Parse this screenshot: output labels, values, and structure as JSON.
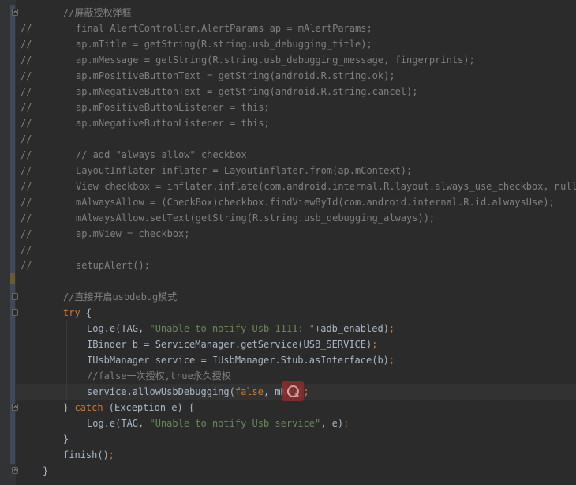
{
  "editor": {
    "lines": [
      {
        "comment_prefix": "",
        "indent": 80,
        "fold": "up",
        "tokens": [
          {
            "t": "//屏蔽授权弹框",
            "c": "#808080"
          }
        ]
      },
      {
        "comment_prefix": "//",
        "indent": 96,
        "tokens": [
          {
            "t": "final AlertController.AlertParams ap = mAlertParams;",
            "c": "#808080"
          }
        ]
      },
      {
        "comment_prefix": "//",
        "indent": 96,
        "tokens": [
          {
            "t": "ap.mTitle = getString(R.string.usb_debugging_title);",
            "c": "#808080"
          }
        ]
      },
      {
        "comment_prefix": "//",
        "indent": 96,
        "tokens": [
          {
            "t": "ap.mMessage = getString(R.string.usb_debugging_message, fingerprints);",
            "c": "#808080"
          }
        ]
      },
      {
        "comment_prefix": "//",
        "indent": 96,
        "tokens": [
          {
            "t": "ap.mPositiveButtonText = getString(android.R.string.ok);",
            "c": "#808080"
          }
        ]
      },
      {
        "comment_prefix": "//",
        "indent": 96,
        "tokens": [
          {
            "t": "ap.mNegativeButtonText = getString(android.R.string.cancel);",
            "c": "#808080"
          }
        ]
      },
      {
        "comment_prefix": "//",
        "indent": 96,
        "tokens": [
          {
            "t": "ap.mPositiveButtonListener = this;",
            "c": "#808080"
          }
        ]
      },
      {
        "comment_prefix": "//",
        "indent": 96,
        "tokens": [
          {
            "t": "ap.mNegativeButtonListener = this;",
            "c": "#808080"
          }
        ]
      },
      {
        "comment_prefix": "//",
        "indent": 96,
        "tokens": []
      },
      {
        "comment_prefix": "//",
        "indent": 96,
        "tokens": [
          {
            "t": "// add \"always allow\" checkbox",
            "c": "#808080"
          }
        ]
      },
      {
        "comment_prefix": "//",
        "indent": 96,
        "tokens": [
          {
            "t": "LayoutInflater inflater = LayoutInflater.from(ap.mContext);",
            "c": "#808080"
          }
        ]
      },
      {
        "comment_prefix": "//",
        "indent": 96,
        "tokens": [
          {
            "t": "View checkbox = inflater.inflate(com.android.internal.R.layout.always_use_checkbox, null);",
            "c": "#808080"
          }
        ]
      },
      {
        "comment_prefix": "//",
        "indent": 96,
        "tokens": [
          {
            "t": "mAlwaysAllow = (CheckBox)checkbox.findViewById(com.android.internal.R.id.alwaysUse);",
            "c": "#808080"
          }
        ]
      },
      {
        "comment_prefix": "//",
        "indent": 96,
        "tokens": [
          {
            "t": "mAlwaysAllow.setText(getString(R.string.usb_debugging_always));",
            "c": "#808080"
          }
        ]
      },
      {
        "comment_prefix": "//",
        "indent": 96,
        "tokens": [
          {
            "t": "ap.mView = checkbox;",
            "c": "#808080"
          }
        ]
      },
      {
        "comment_prefix": "//",
        "indent": 96,
        "tokens": []
      },
      {
        "comment_prefix": "//",
        "indent": 96,
        "tokens": [
          {
            "t": "setupAlert();",
            "c": "#808080"
          }
        ]
      },
      {
        "comment_prefix": "",
        "indent": 80,
        "tokens": []
      },
      {
        "comment_prefix": "",
        "indent": 80,
        "fold": "down",
        "tokens": [
          {
            "t": "//直接开启usbdebug模式",
            "c": "#808080"
          }
        ]
      },
      {
        "comment_prefix": "",
        "indent": 80,
        "fold": "down",
        "tokens": [
          {
            "t": "try",
            "c": "#cc7832"
          },
          {
            "t": " {",
            "c": "#a9b7c6"
          }
        ]
      },
      {
        "comment_prefix": "",
        "indent": 110,
        "tokens": [
          {
            "t": "Log.e(TAG, ",
            "c": "#a9b7c6"
          },
          {
            "t": "\"Unable to notify Usb 1111: \"",
            "c": "#6a8759"
          },
          {
            "t": "+adb_enabled)",
            "c": "#a9b7c6"
          },
          {
            "t": ";",
            "c": "#cc7832"
          }
        ]
      },
      {
        "comment_prefix": "",
        "indent": 110,
        "tokens": [
          {
            "t": "IBinder b = ServiceManager.getService(USB_SERVICE)",
            "c": "#a9b7c6"
          },
          {
            "t": ";",
            "c": "#cc7832"
          }
        ]
      },
      {
        "comment_prefix": "",
        "indent": 110,
        "tokens": [
          {
            "t": "IUsbManager service = IUsbManager.Stub.asInterface(b)",
            "c": "#a9b7c6"
          },
          {
            "t": ";",
            "c": "#cc7832"
          }
        ]
      },
      {
        "comment_prefix": "",
        "indent": 110,
        "tokens": [
          {
            "t": "//false一次授权,true永久授权",
            "c": "#808080"
          }
        ]
      },
      {
        "comment_prefix": "",
        "indent": 110,
        "tokens": [
          {
            "t": "service.allowUsbDebugging(",
            "c": "#a9b7c6"
          },
          {
            "t": "false",
            "c": "#cc7832"
          },
          {
            "t": ", mKey)",
            "c": "#a9b7c6"
          },
          {
            "t": ";",
            "c": "#cc7832"
          }
        ]
      },
      {
        "comment_prefix": "",
        "indent": 80,
        "fold": "up",
        "tokens": [
          {
            "t": "} ",
            "c": "#a9b7c6"
          },
          {
            "t": "catch",
            "c": "#cc7832"
          },
          {
            "t": " (Exception e) {",
            "c": "#a9b7c6"
          }
        ]
      },
      {
        "comment_prefix": "",
        "indent": 110,
        "tokens": [
          {
            "t": "Log.e(TAG, ",
            "c": "#a9b7c6"
          },
          {
            "t": "\"Unable to notify Usb service\"",
            "c": "#6a8759"
          },
          {
            "t": ", e)",
            "c": "#a9b7c6"
          },
          {
            "t": ";",
            "c": "#cc7832"
          }
        ]
      },
      {
        "comment_prefix": "",
        "indent": 80,
        "tokens": [
          {
            "t": "}",
            "c": "#a9b7c6"
          }
        ]
      },
      {
        "comment_prefix": "",
        "indent": 80,
        "tokens": [
          {
            "t": "finish()",
            "c": "#a9b7c6"
          },
          {
            "t": ";",
            "c": "#cc7832"
          }
        ]
      },
      {
        "comment_prefix": "",
        "indent": 54,
        "fold": "up",
        "tokens": [
          {
            "t": "}",
            "c": "#a9b7c6"
          }
        ]
      }
    ]
  },
  "colors": {
    "background": "#2b2b2b",
    "keyword": "#cc7832",
    "string": "#6a8759",
    "comment": "#808080",
    "text": "#a9b7c6"
  },
  "icons": {
    "intention_hint": "intention-bulb-icon",
    "fold": "fold-marker-icon"
  }
}
